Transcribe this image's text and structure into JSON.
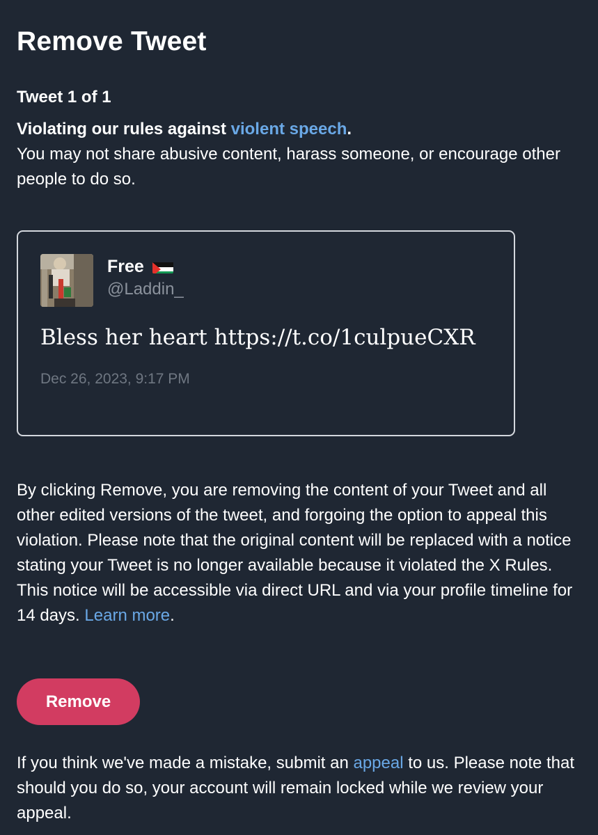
{
  "page": {
    "title": "Remove Tweet",
    "counter": "Tweet 1 of 1"
  },
  "violation": {
    "heading_prefix": "Violating our rules against ",
    "heading_link": "violent speech",
    "heading_suffix": ".",
    "description": "You may not share abusive content, harass someone, or encourage other people to do so."
  },
  "tweet": {
    "display_name": "Free",
    "flag_icon": "palestine-flag-icon",
    "handle": "@Laddin_",
    "text": "Bless her heart https://t.co/1culpueCXR",
    "timestamp": "Dec 26, 2023, 9:17 PM"
  },
  "notice": {
    "body": "By clicking Remove, you are removing the content of your Tweet and all other edited versions of the tweet, and forgoing the option to appeal this violation. Please note that the original content will be replaced with a notice stating your Tweet is no longer available because it violated the X Rules. This notice will be accessible via direct URL and via your profile timeline for 14 days. ",
    "learn_more": "Learn more",
    "suffix": "."
  },
  "actions": {
    "remove_label": "Remove"
  },
  "appeal": {
    "prefix": "If you think we've made a mistake, submit an ",
    "link": "appeal",
    "suffix": " to us. Please note that should you do so, your account will remain locked while we review your appeal."
  },
  "colors": {
    "background": "#1f2733",
    "link": "#6aa8e6",
    "remove_button": "#d23c61",
    "card_border": "#d4d8de"
  }
}
